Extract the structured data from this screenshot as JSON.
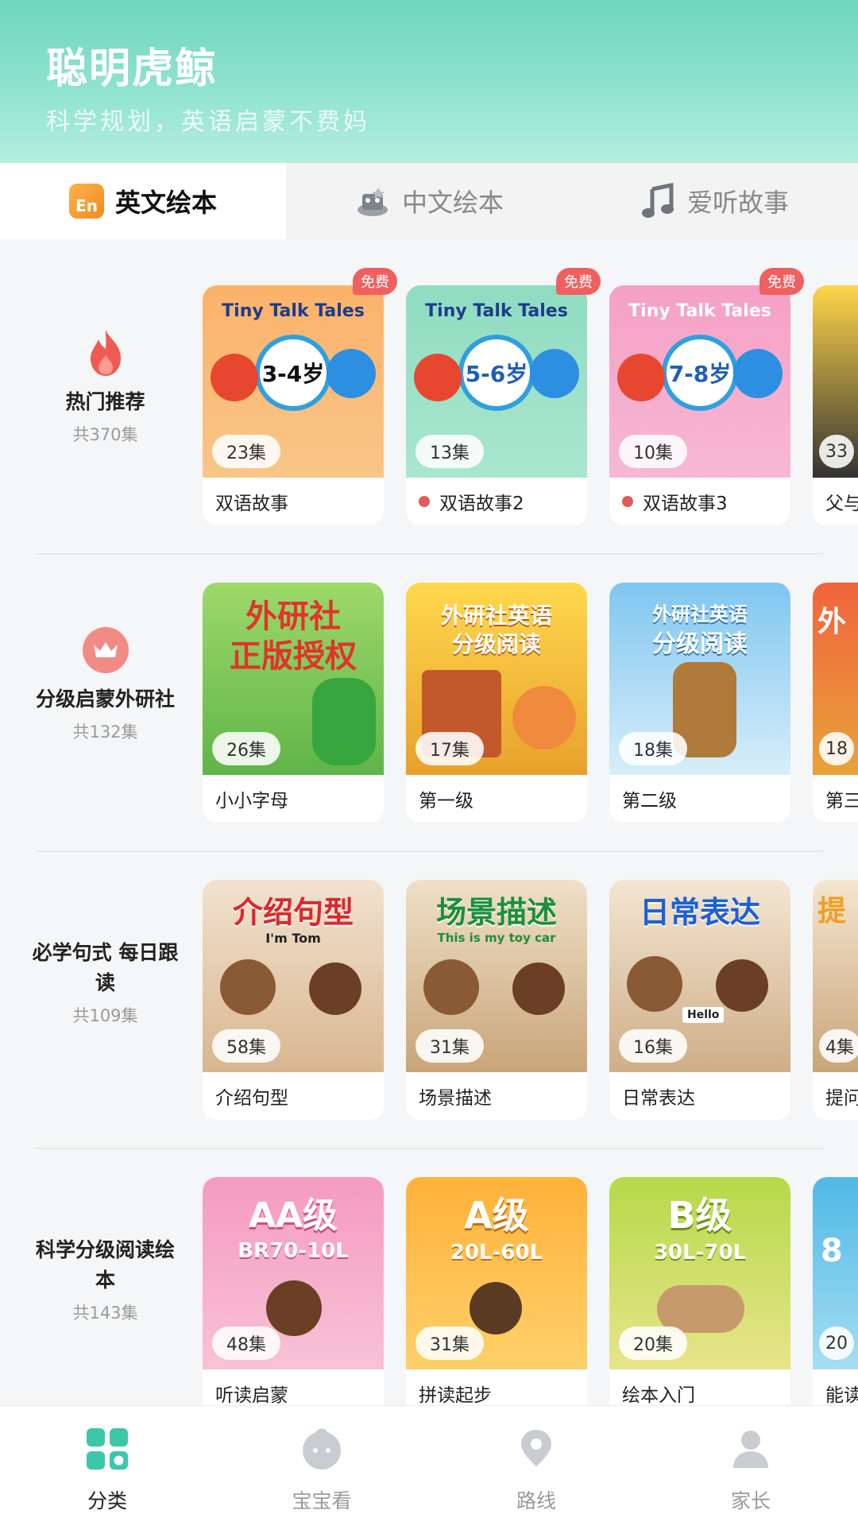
{
  "header": {
    "title": "聪明虎鲸",
    "subtitle": "科学规划，英语启蒙不费妈"
  },
  "tabs": [
    {
      "label": "英文绘本",
      "icon": "en-book-icon"
    },
    {
      "label": "中文绘本",
      "icon": "chinese-book-icon"
    },
    {
      "label": "爱听故事",
      "icon": "music-note-icon"
    }
  ],
  "sections": [
    {
      "name": "热门推荐",
      "count": "共370集",
      "icon": "fire-icon",
      "cards": [
        {
          "cover_title": "Tiny Talk Tales",
          "cover_text": "3-4岁",
          "episodes": "23集",
          "label": "双语故事",
          "badge": "免费"
        },
        {
          "cover_title": "Tiny Talk Tales",
          "cover_text": "5-6岁",
          "episodes": "13集",
          "label": "双语故事2",
          "badge": "免费"
        },
        {
          "cover_title": "Tiny Talk Tales",
          "cover_text": "7-8岁",
          "episodes": "10集",
          "label": "双语故事3",
          "badge": "免费"
        },
        {
          "episodes": "33",
          "label": "父与"
        }
      ]
    },
    {
      "name": "分级启蒙外研社",
      "count": "共132集",
      "icon": "crown-icon",
      "cards": [
        {
          "cover_title": "外研社",
          "cover_text": "正版授权",
          "episodes": "26集",
          "label": "小小字母"
        },
        {
          "cover_title": "外研社英语",
          "cover_text": "分级阅读",
          "episodes": "17集",
          "label": "第一级"
        },
        {
          "cover_title": "外研社英语",
          "cover_text": "分级阅读",
          "episodes": "18集",
          "label": "第二级"
        },
        {
          "cover_title": "外",
          "episodes": "18",
          "label": "第三"
        }
      ]
    },
    {
      "name": "必学句式 每日跟读",
      "count": "共109集",
      "icon": "none",
      "cards": [
        {
          "cover_title": "介绍句型",
          "cover_text": "I'm Tom",
          "episodes": "58集",
          "label": "介绍句型"
        },
        {
          "cover_title": "场景描述",
          "cover_text": "This is my toy car",
          "episodes": "31集",
          "label": "场景描述"
        },
        {
          "cover_title": "日常表达",
          "cover_text": "Hello",
          "episodes": "16集",
          "label": "日常表达"
        },
        {
          "cover_title": "提",
          "episodes": "4集",
          "label": "提问"
        }
      ]
    },
    {
      "name": "科学分级阅读绘本",
      "count": "共143集",
      "icon": "none",
      "cards": [
        {
          "cover_title": "AA级",
          "cover_text": "BR70-10L",
          "episodes": "48集",
          "label": "听读启蒙"
        },
        {
          "cover_title": "A级",
          "cover_text": "20L-60L",
          "episodes": "31集",
          "label": "拼读起步"
        },
        {
          "cover_title": "B级",
          "cover_text": "30L-70L",
          "episodes": "20集",
          "label": "绘本入门"
        },
        {
          "cover_title": "8",
          "episodes": "20",
          "label": "能读"
        }
      ]
    }
  ],
  "bottom_nav": [
    {
      "label": "分类",
      "icon": "category-grid-icon",
      "active": true
    },
    {
      "label": "宝宝看",
      "icon": "baby-face-icon",
      "active": false
    },
    {
      "label": "路线",
      "icon": "location-pin-icon",
      "active": false
    },
    {
      "label": "家长",
      "icon": "person-icon",
      "active": false
    }
  ],
  "colors": {
    "header_start": "#6fd6be",
    "accent": "#3cc7a8",
    "badge": "#f06060"
  }
}
